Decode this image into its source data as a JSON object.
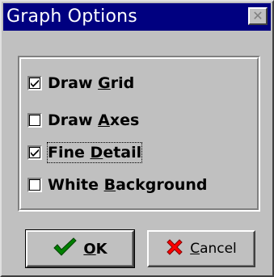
{
  "window": {
    "title": "Graph Options",
    "close_glyph": "✕"
  },
  "options": [
    {
      "pre": "Draw ",
      "accel": "G",
      "post": "rid",
      "checked": true
    },
    {
      "pre": "Draw ",
      "accel": "A",
      "post": "xes",
      "checked": false
    },
    {
      "pre": "Fine ",
      "accel": "D",
      "post": "etail",
      "checked": true
    },
    {
      "pre": "White ",
      "accel": "B",
      "post": "ackground",
      "checked": false
    }
  ],
  "buttons": {
    "ok": {
      "accel": "O",
      "post": "K",
      "icon": "checkmark-icon",
      "icon_color": "#008000"
    },
    "cancel": {
      "accel": "C",
      "post": "ancel",
      "icon": "x-icon",
      "icon_color": "#ff0000"
    }
  }
}
